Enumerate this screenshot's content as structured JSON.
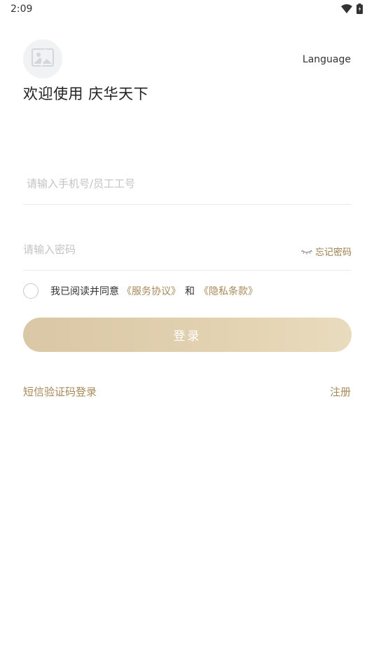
{
  "status_bar": {
    "time": "2:09",
    "icons": [
      "wifi-icon",
      "battery-icon"
    ]
  },
  "header": {
    "avatar_icon": "image-placeholder-icon",
    "language_label": "Language",
    "welcome_title": "欢迎使用 庆华天下"
  },
  "form": {
    "phone_placeholder": "请输入手机号/员工工号",
    "phone_value": "",
    "password_placeholder": "请输入密码",
    "password_value": "",
    "password_visibility_icon": "eye-closed-icon",
    "forgot_password_label": "忘记密码"
  },
  "agreement": {
    "checked": false,
    "prefix_text": "我已阅读并同意",
    "service_link": "《服务协议》",
    "and_text": "和",
    "privacy_link": "《隐私条款》"
  },
  "login_button_label": "登录",
  "footer": {
    "sms_login_label": "短信验证码登录",
    "register_label": "注册"
  },
  "colors": {
    "accent": "#a8895a",
    "button_gradient_start": "#d9c7a5",
    "button_gradient_end": "#e9dbbd",
    "placeholder": "#c3c3c3",
    "divider": "#ececec"
  }
}
